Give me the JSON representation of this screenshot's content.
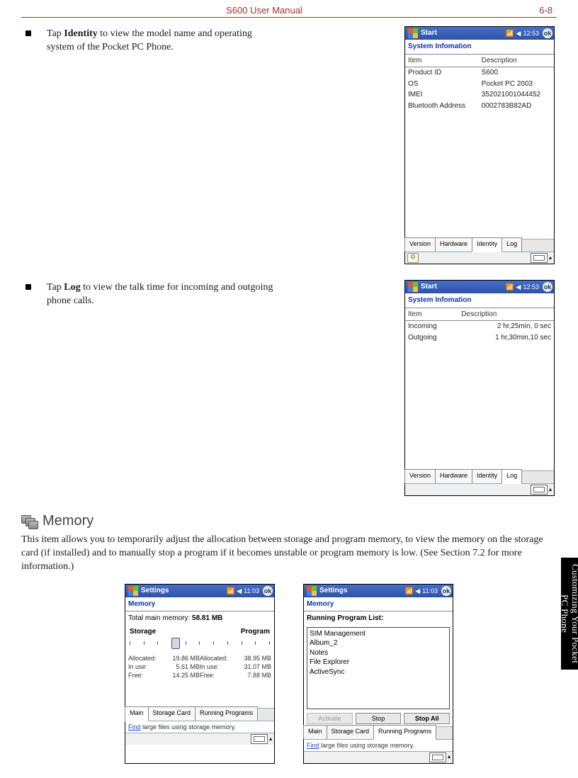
{
  "header": {
    "doc_title": "S600 User Manual",
    "page_num": "6-8"
  },
  "chapter_tab": "Customizing Your\nPocket PC Phone",
  "bullets": {
    "identity": {
      "pre": "Tap ",
      "bold": "Identity",
      "post": " to view the model name and operating system of the Pocket PC Phone."
    },
    "log": {
      "pre": "Tap ",
      "bold": "Log",
      "post": " to view the talk time for incoming and outgoing phone calls."
    }
  },
  "shot_common": {
    "start_label": "Start",
    "clock": "12:53",
    "ok": "ok",
    "app_title": "System Infomation",
    "col_item": "Item",
    "col_desc": "Description",
    "tabs": {
      "version": "Version",
      "hardware": "Hardware",
      "identity": "Identity",
      "log": "Log"
    }
  },
  "identity_rows": [
    {
      "item": "Product ID",
      "desc": "S600"
    },
    {
      "item": "OS",
      "desc": "Pocket PC 2003"
    },
    {
      "item": "IMEI",
      "desc": "352021001044452"
    },
    {
      "item": "Bluetooth Address",
      "desc": "0002783B82AD"
    }
  ],
  "log_rows": [
    {
      "item": "Incoming",
      "desc": "2 hr,25min, 0 sec"
    },
    {
      "item": "Outgoing",
      "desc": "1 hr,30min,10 sec"
    }
  ],
  "memory": {
    "heading": "Memory",
    "description": "This item allows you to temporarily adjust the allocation between storage and program memory, to view the memory on the storage card (if installed) and to manually stop a program if it becomes unstable or program memory is low. (See Section 7.2 for more information.)"
  },
  "mem_common": {
    "title": "Settings",
    "clock": "11:03",
    "ok": "ok",
    "app_title": "Memory",
    "helper": {
      "link": "Find",
      "rest": " large files using storage memory."
    },
    "tabs": {
      "main": "Main",
      "card": "Storage Card",
      "running": "Running Programs"
    }
  },
  "mem_main": {
    "total_label": "Total main memory:",
    "total_value": "58.81 MB",
    "storage_label": "Storage",
    "program_label": "Program",
    "rows": {
      "allocated": {
        "label": "Allocated:",
        "storage": "19.86 MB",
        "program": "38.95 MB"
      },
      "inuse": {
        "label": "In use:",
        "storage": "5.61 MB",
        "program": "31.07 MB"
      },
      "free": {
        "label": "Free:",
        "storage": "14.25 MB",
        "program": "7.88 MB"
      }
    }
  },
  "mem_running": {
    "list_label": "Running Program List:",
    "items": [
      "SIM Management",
      "Album_2",
      "Notes",
      "File Explorer",
      "ActiveSync"
    ],
    "btn_activate": "Activate",
    "btn_stop": "Stop",
    "btn_stop_all": "Stop All"
  }
}
